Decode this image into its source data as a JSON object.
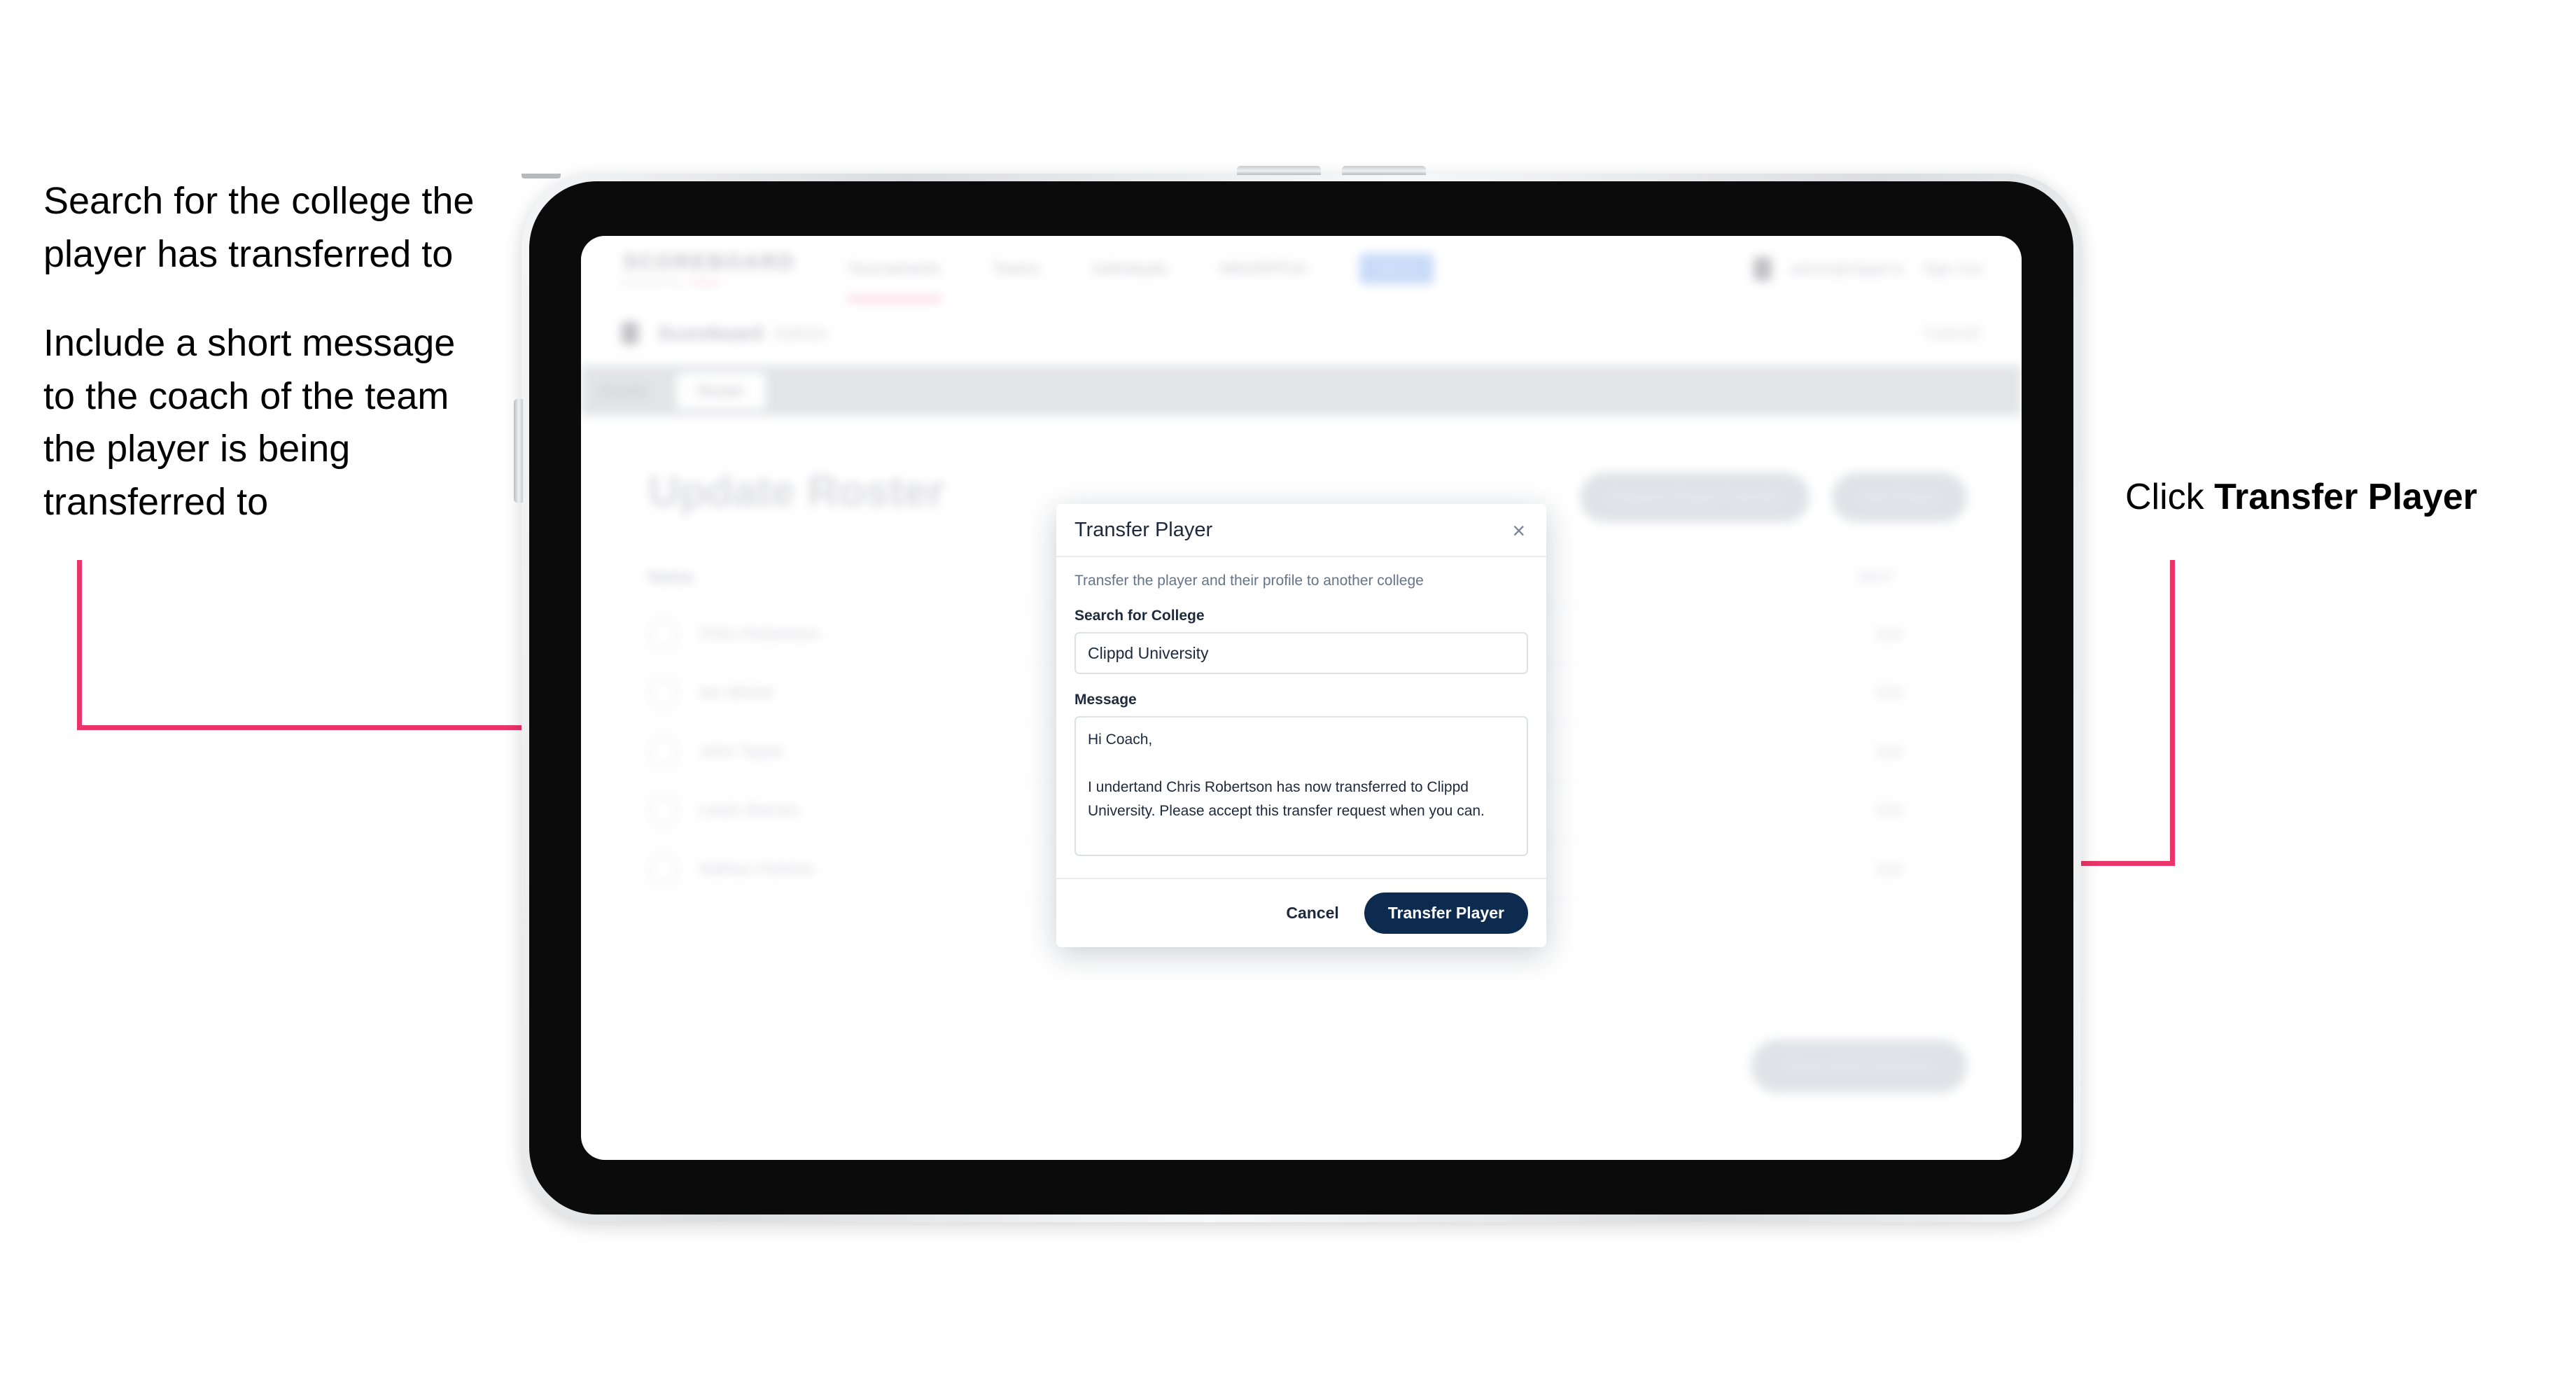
{
  "annotations": {
    "left_line_1": "Search for the college the player has transferred to",
    "left_line_2": "Include a short message to the coach of the team the player is being transferred to",
    "right_prefix": "Click ",
    "right_bold": "Transfer Player"
  },
  "app": {
    "brand": "SCOREBOARD",
    "brand_sub_a": "powered by",
    "brand_sub_b": "clippd",
    "nav": [
      {
        "label": "Tournaments"
      },
      {
        "label": "Teams"
      },
      {
        "label": "Individuals"
      },
      {
        "label": "WAGR/PGA"
      }
    ],
    "nav_pill": "Admin",
    "nav_email": "admin@clippd.io",
    "nav_signout": "Sign Out",
    "breadcrumb_main": "Scoreboard",
    "breadcrumb_sub": "Admin",
    "breadcrumb_action": "Cancel",
    "tabs": [
      {
        "label": "Details"
      },
      {
        "label": "Roster"
      }
    ],
    "page_title": "Update Roster",
    "header_buttons": [
      "Request Player Transfer",
      "Add Player"
    ],
    "table_headers": [
      "Name",
      "EDIT"
    ],
    "rows": [
      {
        "name": "Chris Robertson",
        "action": "Edit"
      },
      {
        "name": "Ian Winter",
        "action": "Edit"
      },
      {
        "name": "John Taylor",
        "action": "Edit"
      },
      {
        "name": "Lewis Barnes",
        "action": "Edit"
      },
      {
        "name": "Nathan Holmes",
        "action": "Edit"
      }
    ],
    "bottom_button": "Save And Continue"
  },
  "modal": {
    "title": "Transfer Player",
    "close_icon": "×",
    "description": "Transfer the player and their profile to another college",
    "college_label": "Search for College",
    "college_value": "Clippd University",
    "college_placeholder": "Search for College",
    "message_label": "Message",
    "message_value": "Hi Coach,\n\nI undertand Chris Robertson has now transferred to Clippd University. Please accept this transfer request when you can.",
    "message_placeholder": "Message",
    "cancel_label": "Cancel",
    "submit_label": "Transfer Player"
  },
  "colors": {
    "accent_pink": "#EB3469",
    "button_navy": "#0D2B4E",
    "text_dark": "#1E293B",
    "muted": "#64748B"
  }
}
